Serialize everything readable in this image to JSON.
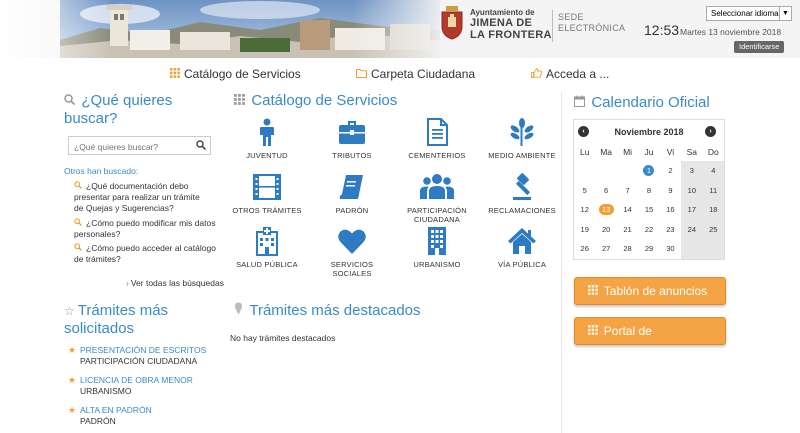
{
  "header": {
    "ayuntamiento": "Ayuntamiento de",
    "town_line1": "JIMENA DE",
    "town_line2": "LA FRONTERA",
    "sede_line1": "SEDE",
    "sede_line2": "ELECTRÓNICA",
    "language_select": "Seleccionar idioma",
    "time": "12:53",
    "date": "Martes 13 noviembre 2018",
    "identify_button": "Identificarse"
  },
  "nav": {
    "catalog": "Catálogo de Servicios",
    "folder": "Carpeta Ciudadana",
    "access": "Acceda a ..."
  },
  "search": {
    "title_line1": "¿Qué quieres",
    "title_line2": "buscar?",
    "placeholder": "¿Qué quieres buscar?",
    "searched_label": "Otros han buscado:",
    "queries": [
      {
        "line1": "¿Qué documentación debo",
        "line2": "presentar para realizar un trámite",
        "line3": "de Quejas y Sugerencias?"
      },
      {
        "line1": "¿Cómo puedo modificar mis datos",
        "line2": "personales?"
      },
      {
        "line1": "¿Cómo puedo acceder al catálogo",
        "line2": "de trámites?"
      }
    ],
    "see_all": "Ver todas las búsquedas"
  },
  "catalog": {
    "title": "Catálogo de Servicios",
    "items": [
      {
        "line1": "JUVENTUD",
        "line2": "",
        "icon": "person-icon"
      },
      {
        "line1": "TRIBUTOS",
        "line2": "",
        "icon": "briefcase-icon"
      },
      {
        "line1": "CEMENTERIOS",
        "line2": "",
        "icon": "document-icon"
      },
      {
        "line1": "MEDIO AMBIENTE",
        "line2": "",
        "icon": "leaf-icon"
      },
      {
        "line1": "OTROS TRÁMITES",
        "line2": "",
        "icon": "film-icon"
      },
      {
        "line1": "PADRÓN",
        "line2": "",
        "icon": "book-icon"
      },
      {
        "line1": "PARTICIPACIÓN",
        "line2": "CIUDADANA",
        "icon": "group-icon"
      },
      {
        "line1": "RECLAMACIONES",
        "line2": "",
        "icon": "gavel-icon"
      },
      {
        "line1": "SALUD PÚBLICA",
        "line2": "",
        "icon": "hospital-icon"
      },
      {
        "line1": "SERVICIOS",
        "line2": "SOCIALES",
        "icon": "heart-icon"
      },
      {
        "line1": "URBANISMO",
        "line2": "",
        "icon": "building-icon"
      },
      {
        "line1": "VÍA PÚBLICA",
        "line2": "",
        "icon": "home-icon"
      }
    ]
  },
  "tramites": {
    "title_line1": "Trámites más",
    "title_line2": "solicitados",
    "items": [
      {
        "title": "PRESENTACIÓN DE ESCRITOS",
        "subtitle": "PARTICIPACIÓN CIUDADANA"
      },
      {
        "title": "LICENCIA DE OBRA MENOR",
        "subtitle": "URBANISMO"
      },
      {
        "title": "ALTA EN PADRÓN",
        "subtitle": "PADRÓN"
      }
    ]
  },
  "destacados": {
    "title": "Trámites más destacados",
    "empty": "No hay trámites destacados"
  },
  "calendar": {
    "title": "Calendario Oficial",
    "month": "Noviembre 2018",
    "prev": "‹",
    "next": "›",
    "days_of_week": [
      "Lu",
      "Ma",
      "Mi",
      "Ju",
      "Vi",
      "Sa",
      "Do"
    ],
    "days": [
      "",
      "",
      "",
      "1",
      "2",
      "3",
      "4",
      "5",
      "6",
      "7",
      "8",
      "9",
      "10",
      "11",
      "12",
      "13",
      "14",
      "15",
      "16",
      "17",
      "18",
      "19",
      "20",
      "21",
      "22",
      "23",
      "24",
      "25",
      "26",
      "27",
      "28",
      "29",
      "30",
      "",
      ""
    ],
    "today": "1",
    "marked": "13"
  },
  "buttons": {
    "tablon": "Tablón de anuncios",
    "portal": "Portal de transparencia"
  },
  "colors": {
    "accent_blue": "#3a8ac8",
    "accent_orange": "#f5a445"
  }
}
